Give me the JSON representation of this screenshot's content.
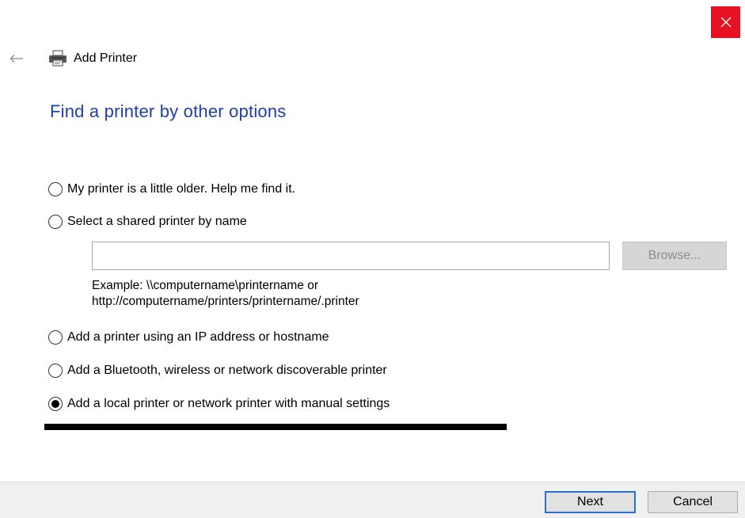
{
  "window": {
    "title": "Add Printer"
  },
  "page": {
    "heading": "Find a printer by other options"
  },
  "options": [
    {
      "label": "My printer is a little older. Help me find it.",
      "selected": false
    },
    {
      "label": "Select a shared printer by name",
      "selected": false
    },
    {
      "label": "Add a printer using an IP address or hostname",
      "selected": false
    },
    {
      "label": "Add a Bluetooth, wireless or network discoverable printer",
      "selected": false
    },
    {
      "label": "Add a local printer or network printer with manual settings",
      "selected": true
    }
  ],
  "shared_printer": {
    "value": "",
    "browse_label": "Browse...",
    "example_line1": "Example: \\\\computername\\printername or",
    "example_line2": "http://computername/printers/printername/.printer"
  },
  "footer": {
    "next_label": "Next",
    "cancel_label": "Cancel"
  },
  "colors": {
    "close_bg": "#e81123",
    "heading": "#1e3fa8",
    "next_border": "#2b6fcf"
  },
  "icons": {
    "close": "close-icon",
    "back": "back-arrow-icon",
    "printer": "printer-icon"
  }
}
